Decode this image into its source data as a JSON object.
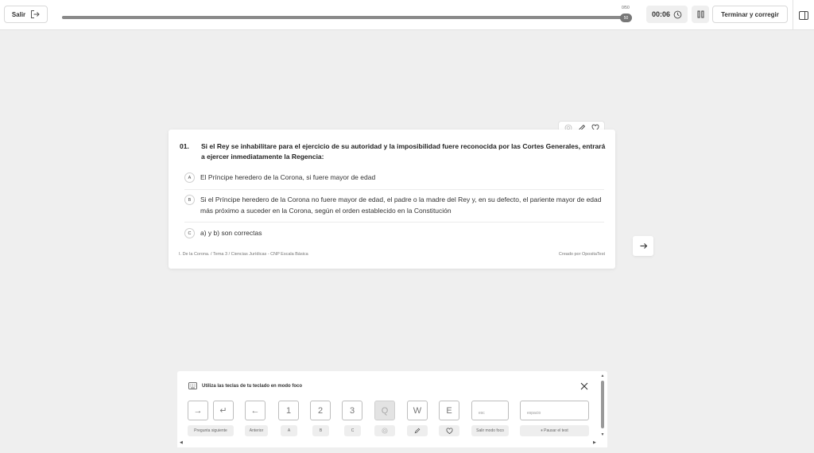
{
  "header": {
    "exit_label": "Salir",
    "progress_count": "0/50",
    "progress_knob": "50",
    "progress_fraction": 1.0,
    "timer": "00:06",
    "finish_label": "Terminar y corregir"
  },
  "question": {
    "number": "01.",
    "text": "Si el Rey se inhabilitare para el ejercicio de su autoridad y la imposibilidad fuere reconocida por las Cortes Generales, entrará a ejercer inmediatamente la Regencia:",
    "answers": [
      {
        "letter": "A",
        "text": "El Príncipe heredero de la Corona, si fuere mayor de edad"
      },
      {
        "letter": "B",
        "text": "Si el Príncipe heredero de la Corona no fuere mayor de edad, el padre o la madre del Rey y, en su defecto, el pariente mayor de edad más próximo a suceder en la Corona, según el orden establecido en la Constitución"
      },
      {
        "letter": "C",
        "text": "a) y b) son correctas"
      }
    ],
    "footer_left": "I. De la Corona. / Tema 3 / Ciencias Jurídicas - CNP Escala Básica",
    "footer_right": "Creado por OpositaTest"
  },
  "keyboard_help": {
    "title": "Utiliza las teclas de tu teclado en modo foco",
    "keys": [
      {
        "key": "→",
        "label": "Pregunta siguiente"
      },
      {
        "key": "↵",
        "label": ""
      },
      {
        "key": "←",
        "label": "Anterior"
      },
      {
        "key": "1",
        "label": "A"
      },
      {
        "key": "2",
        "label": "B"
      },
      {
        "key": "3",
        "label": "C"
      },
      {
        "key": "Q",
        "label": ""
      },
      {
        "key": "W",
        "label": ""
      },
      {
        "key": "E",
        "label": ""
      },
      {
        "key": "esc",
        "label": "Salir modo foco"
      },
      {
        "key": "espacio",
        "label": "⏸ Pausar el test"
      }
    ]
  },
  "colors": {
    "background": "#efefef",
    "progress_fill": "#8a8a8a",
    "card": "#ffffff"
  }
}
